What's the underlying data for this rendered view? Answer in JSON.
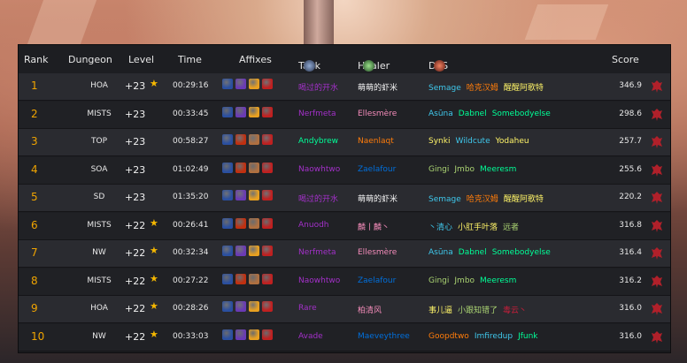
{
  "header": {
    "rank": "Rank",
    "dungeon": "Dungeon",
    "level": "Level",
    "time": "Time",
    "affixes": "Affixes",
    "tank": "Tank",
    "healer": "Healer",
    "dps": "DPS",
    "score": "Score"
  },
  "colors": {
    "rank": "#f0a400",
    "star": "#f5b700",
    "priest": "#f2f2f2",
    "dh": "#a330c9",
    "mage": "#3fc7eb",
    "warrior": "#c69b6d",
    "hunter": "#aad372",
    "rogue": "#fff468",
    "monk": "#00ff98",
    "druid": "#ff7c0a",
    "paladin": "#f48cba",
    "shaman": "#0070dd",
    "dk": "#c41e3a",
    "horde": "#b0202a"
  },
  "affix_icons": [
    "tyrannical-icon",
    "bursting-icon",
    "volcanic-icon",
    "explosive-icon",
    "raging-icon",
    "sanguine-icon"
  ],
  "rows": [
    {
      "rank": "1",
      "dungeon": "HOA",
      "level": "+23",
      "star": true,
      "time": "00:29:16",
      "affixes": [
        "#2a4fa0",
        "#6a3ab5",
        "#e8a020",
        "#c02020"
      ],
      "tank": {
        "name": "喝过的开水",
        "color": "#a330c9"
      },
      "healer": {
        "name": "萌萌的虾米",
        "color": "#f2f2f2"
      },
      "dps": [
        {
          "name": "Semage",
          "color": "#3fc7eb"
        },
        {
          "name": "哈克汉姆",
          "color": "#ff7c0a"
        },
        {
          "name": "醒醒阿歌特",
          "color": "#fff468"
        }
      ],
      "score": "346.9"
    },
    {
      "rank": "2",
      "dungeon": "MISTS",
      "level": "+23",
      "star": false,
      "time": "00:33:45",
      "affixes": [
        "#2a4fa0",
        "#6a3ab5",
        "#e8a020",
        "#c02020"
      ],
      "tank": {
        "name": "Nerfmeta",
        "color": "#a330c9"
      },
      "healer": {
        "name": "Ellesmère",
        "color": "#f48cba"
      },
      "dps": [
        {
          "name": "Asūna",
          "color": "#3fc7eb"
        },
        {
          "name": "Dabnel",
          "color": "#00ff98"
        },
        {
          "name": "Somebodyelse",
          "color": "#00ff98"
        }
      ],
      "score": "298.6"
    },
    {
      "rank": "3",
      "dungeon": "TOP",
      "level": "+23",
      "star": false,
      "time": "00:58:27",
      "affixes": [
        "#2a4fa0",
        "#c03010",
        "#b07040",
        "#c02020"
      ],
      "tank": {
        "name": "Andybrew",
        "color": "#00ff98"
      },
      "healer": {
        "name": "Naenlaqt",
        "color": "#ff7c0a"
      },
      "dps": [
        {
          "name": "Synki",
          "color": "#fff468"
        },
        {
          "name": "Wildcute",
          "color": "#3fc7eb"
        },
        {
          "name": "Yodaheu",
          "color": "#fff468"
        }
      ],
      "score": "257.7"
    },
    {
      "rank": "4",
      "dungeon": "SOA",
      "level": "+23",
      "star": false,
      "time": "01:02:49",
      "affixes": [
        "#2a4fa0",
        "#c03010",
        "#b07040",
        "#c02020"
      ],
      "tank": {
        "name": "Naowhtwo",
        "color": "#a330c9"
      },
      "healer": {
        "name": "Zaelafour",
        "color": "#0070dd"
      },
      "dps": [
        {
          "name": "Gingi",
          "color": "#aad372"
        },
        {
          "name": "Jmbo",
          "color": "#aad372"
        },
        {
          "name": "Meeresm",
          "color": "#00ff98"
        }
      ],
      "score": "255.6"
    },
    {
      "rank": "5",
      "dungeon": "SD",
      "level": "+23",
      "star": false,
      "time": "01:35:20",
      "affixes": [
        "#2a4fa0",
        "#6a3ab5",
        "#e8a020",
        "#c02020"
      ],
      "tank": {
        "name": "喝过的开水",
        "color": "#a330c9"
      },
      "healer": {
        "name": "萌萌的虾米",
        "color": "#f2f2f2"
      },
      "dps": [
        {
          "name": "Semage",
          "color": "#3fc7eb"
        },
        {
          "name": "哈克汉姆",
          "color": "#ff7c0a"
        },
        {
          "name": "醒醒阿歌特",
          "color": "#fff468"
        }
      ],
      "score": "220.2"
    },
    {
      "rank": "6",
      "dungeon": "MISTS",
      "level": "+22",
      "star": true,
      "time": "00:26:41",
      "affixes": [
        "#2a4fa0",
        "#c03010",
        "#b07040",
        "#c02020"
      ],
      "tank": {
        "name": "Anuodh",
        "color": "#a330c9"
      },
      "healer": {
        "name": "麟丨麟丶",
        "color": "#f48cba"
      },
      "dps": [
        {
          "name": "丶清心",
          "color": "#3fc7eb"
        },
        {
          "name": "小肛手叶落",
          "color": "#fff468"
        },
        {
          "name": "远者",
          "color": "#aad372"
        }
      ],
      "score": "316.8"
    },
    {
      "rank": "7",
      "dungeon": "NW",
      "level": "+22",
      "star": true,
      "time": "00:32:34",
      "affixes": [
        "#2a4fa0",
        "#6a3ab5",
        "#e8a020",
        "#c02020"
      ],
      "tank": {
        "name": "Nerfmeta",
        "color": "#a330c9"
      },
      "healer": {
        "name": "Ellesmère",
        "color": "#f48cba"
      },
      "dps": [
        {
          "name": "Asūna",
          "color": "#3fc7eb"
        },
        {
          "name": "Dabnel",
          "color": "#00ff98"
        },
        {
          "name": "Somebodyelse",
          "color": "#00ff98"
        }
      ],
      "score": "316.4"
    },
    {
      "rank": "8",
      "dungeon": "MISTS",
      "level": "+22",
      "star": true,
      "time": "00:27:22",
      "affixes": [
        "#2a4fa0",
        "#c03010",
        "#b07040",
        "#c02020"
      ],
      "tank": {
        "name": "Naowhtwo",
        "color": "#a330c9"
      },
      "healer": {
        "name": "Zaelafour",
        "color": "#0070dd"
      },
      "dps": [
        {
          "name": "Gingi",
          "color": "#aad372"
        },
        {
          "name": "Jmbo",
          "color": "#aad372"
        },
        {
          "name": "Meeresm",
          "color": "#00ff98"
        }
      ],
      "score": "316.2"
    },
    {
      "rank": "9",
      "dungeon": "HOA",
      "level": "+22",
      "star": true,
      "time": "00:28:26",
      "affixes": [
        "#2a4fa0",
        "#6a3ab5",
        "#e8a020",
        "#c02020"
      ],
      "tank": {
        "name": "Rare",
        "color": "#a330c9"
      },
      "healer": {
        "name": "柏清风",
        "color": "#f48cba"
      },
      "dps": [
        {
          "name": "事儿逼",
          "color": "#fff468"
        },
        {
          "name": "小跟知错了",
          "color": "#aad372"
        },
        {
          "name": "毒云丶",
          "color": "#c41e3a"
        }
      ],
      "score": "316.0"
    },
    {
      "rank": "10",
      "dungeon": "NW",
      "level": "+22",
      "star": true,
      "time": "00:33:03",
      "affixes": [
        "#2a4fa0",
        "#6a3ab5",
        "#e8a020",
        "#c02020"
      ],
      "tank": {
        "name": "Avade",
        "color": "#a330c9"
      },
      "healer": {
        "name": "Maeveythree",
        "color": "#0070dd"
      },
      "dps": [
        {
          "name": "Goopdtwo",
          "color": "#ff7c0a"
        },
        {
          "name": "Imfiredup",
          "color": "#3fc7eb"
        },
        {
          "name": "Jfunk",
          "color": "#00ff98"
        }
      ],
      "score": "316.0"
    }
  ]
}
